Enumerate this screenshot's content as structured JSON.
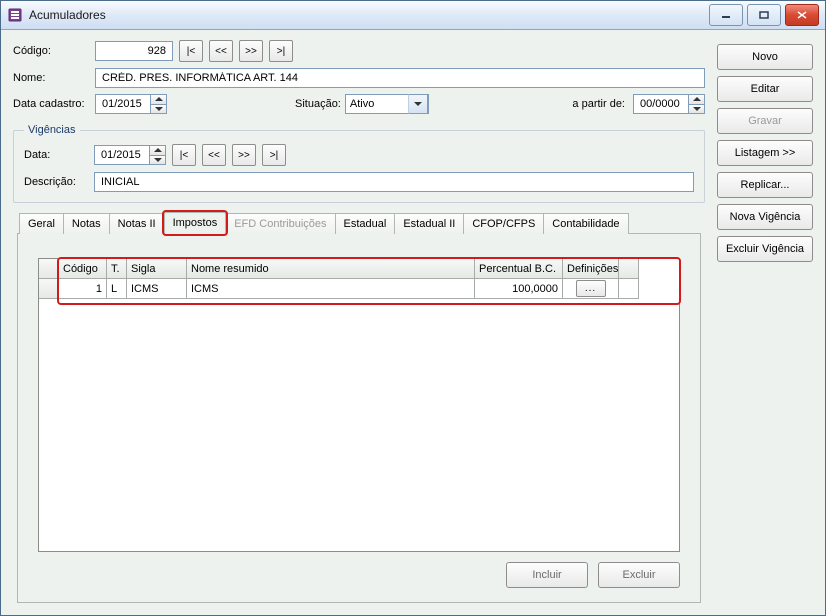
{
  "window": {
    "title": "Acumuladores"
  },
  "header": {
    "codigo_label": "Código:",
    "codigo_value": "928",
    "nome_label": "Nome:",
    "nome_value": "CRÉD. PRES. INFORMÁTICA ART. 144",
    "data_cadastro_label": "Data cadastro:",
    "data_cadastro_value": "01/2015",
    "situacao_label": "Situação:",
    "situacao_value": "Ativo",
    "apartir_label": "a partir de:",
    "apartir_value": "00/0000",
    "nav": {
      "first": "|<",
      "prev": "<<",
      "next": ">>",
      "last": ">|"
    }
  },
  "vigencias": {
    "legend": "Vigências",
    "data_label": "Data:",
    "data_value": "01/2015",
    "descricao_label": "Descrição:",
    "descricao_value": "INICIAL",
    "nav": {
      "first": "|<",
      "prev": "<<",
      "next": ">>",
      "last": ">|"
    }
  },
  "tabs": [
    {
      "id": "geral",
      "label": "Geral",
      "disabled": false
    },
    {
      "id": "notas",
      "label": "Notas",
      "disabled": false
    },
    {
      "id": "notas2",
      "label": "Notas II",
      "disabled": false
    },
    {
      "id": "impostos",
      "label": "Impostos",
      "disabled": false
    },
    {
      "id": "efd",
      "label": "EFD Contribuições",
      "disabled": true
    },
    {
      "id": "estadual",
      "label": "Estadual",
      "disabled": false
    },
    {
      "id": "estadual2",
      "label": "Estadual II",
      "disabled": false
    },
    {
      "id": "cfop",
      "label": "CFOP/CFPS",
      "disabled": false
    },
    {
      "id": "contab",
      "label": "Contabilidade",
      "disabled": false
    }
  ],
  "active_tab": "impostos",
  "grid": {
    "columns": [
      "",
      "Código",
      "T.",
      "Sigla",
      "Nome resumido",
      "Percentual B.C.",
      "Definições",
      ""
    ],
    "rows": [
      {
        "codigo": "1",
        "t": "L",
        "sigla": "ICMS",
        "nome": "ICMS",
        "pct": "100,0000",
        "def": "..."
      }
    ]
  },
  "grid_buttons": {
    "incluir": "Incluir",
    "excluir": "Excluir"
  },
  "sidebar": {
    "novo": "Novo",
    "editar": "Editar",
    "gravar": "Gravar",
    "listagem": "Listagem >>",
    "replicar": "Replicar...",
    "nova_vig": "Nova Vigência",
    "excl_vig": "Excluir Vigência"
  }
}
